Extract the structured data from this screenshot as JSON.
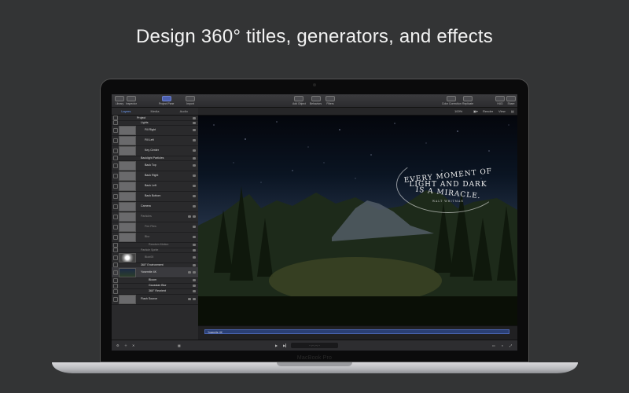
{
  "headline": "Design 360° titles, generators, and effects",
  "laptop_label": "MacBook Pro",
  "toolbar": {
    "library": "Library",
    "inspector": "Inspector",
    "project_pane": "Project Pane",
    "import": "Import",
    "add_object": "Add Object",
    "behaviors": "Behaviors",
    "filters": "Filters",
    "color_correction": "Color Correction",
    "replicate": "Replicate",
    "hud": "HUD",
    "share": "Share"
  },
  "panel_tabs": [
    "Layers",
    "Media",
    "Audio"
  ],
  "viewer_bar": {
    "zoom": "100%",
    "render": "Render",
    "view": "View"
  },
  "layers": [
    {
      "label": "Project",
      "indent": 0
    },
    {
      "label": "Lights",
      "indent": 1
    },
    {
      "label": "Fill Right",
      "indent": 2
    },
    {
      "label": "Fill Left",
      "indent": 2
    },
    {
      "label": "Key Center",
      "indent": 2
    },
    {
      "label": "Backlight Particles",
      "indent": 1
    },
    {
      "label": "Back Top",
      "indent": 2
    },
    {
      "label": "Back Right",
      "indent": 2
    },
    {
      "label": "Back Left",
      "indent": 2
    },
    {
      "label": "Back Bottom",
      "indent": 2
    },
    {
      "label": "Camera",
      "indent": 1
    },
    {
      "label": "Particles",
      "indent": 1
    },
    {
      "label": "Fire Flies",
      "indent": 2
    },
    {
      "label": "Blur",
      "indent": 2
    },
    {
      "label": "Random Motion",
      "indent": 3
    },
    {
      "label": "Particle Sprite",
      "indent": 1
    },
    {
      "label": "Blob05",
      "indent": 2
    },
    {
      "label": "360° Environment",
      "indent": 1
    },
    {
      "label": "Yosemite 4K",
      "indent": 1
    },
    {
      "label": "Bloom",
      "indent": 3
    },
    {
      "label": "Gaussian Blur",
      "indent": 3
    },
    {
      "label": "360° Reorient",
      "indent": 3
    },
    {
      "label": "Flash Source",
      "indent": 1
    }
  ],
  "overlay": {
    "line1": "EVERY MOMENT OF",
    "line2": "LIGHT AND DARK",
    "line3": "IS A MIRACLE.",
    "line4": "WALT WHITMAN"
  },
  "timeline": {
    "clip_label": "Yosemite 4K"
  },
  "colors": {
    "accent": "#4b66b3",
    "background": "#333435"
  }
}
